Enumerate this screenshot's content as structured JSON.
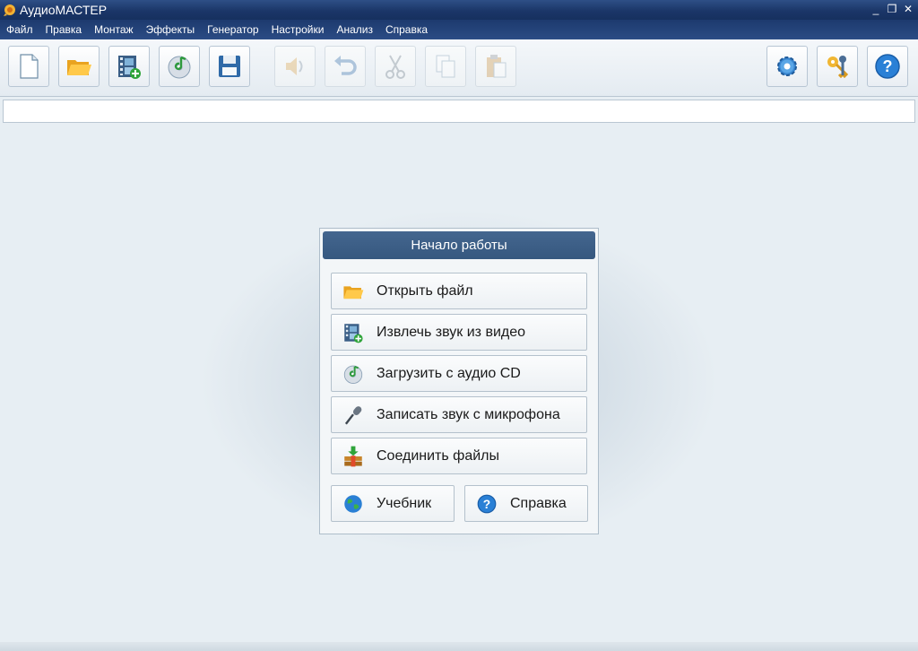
{
  "window": {
    "title": "АудиоМАСТЕР",
    "controls": {
      "minimize": "_",
      "restore": "❐",
      "close": "✕"
    }
  },
  "menu": {
    "items": [
      "Файл",
      "Правка",
      "Монтаж",
      "Эффекты",
      "Генератор",
      "Настройки",
      "Анализ",
      "Справка"
    ]
  },
  "toolbar": {
    "buttons": [
      {
        "icon": "new-file-icon",
        "enabled": true
      },
      {
        "icon": "open-folder-icon",
        "enabled": true
      },
      {
        "icon": "extract-video-icon",
        "enabled": true
      },
      {
        "icon": "audio-cd-icon",
        "enabled": true
      },
      {
        "icon": "save-icon",
        "enabled": true
      },
      {
        "icon": "speaker-icon",
        "enabled": false
      },
      {
        "icon": "undo-icon",
        "enabled": false
      },
      {
        "icon": "cut-icon",
        "enabled": false
      },
      {
        "icon": "copy-icon",
        "enabled": false
      },
      {
        "icon": "paste-icon",
        "enabled": false
      },
      {
        "icon": "settings-gear-icon",
        "enabled": true
      },
      {
        "icon": "keys-icon",
        "enabled": true
      },
      {
        "icon": "help-icon",
        "enabled": true
      }
    ]
  },
  "start_panel": {
    "title": "Начало работы",
    "actions": [
      {
        "label": "Открыть файл",
        "icon": "open-folder-icon"
      },
      {
        "label": "Извлечь звук из видео",
        "icon": "extract-video-icon"
      },
      {
        "label": "Загрузить с аудио CD",
        "icon": "audio-cd-icon"
      },
      {
        "label": "Записать звук с микрофона",
        "icon": "microphone-icon"
      },
      {
        "label": "Соединить файлы",
        "icon": "join-files-icon"
      }
    ],
    "tutorial_label": "Учебник",
    "help_label": "Справка"
  },
  "colors": {
    "titlebar": "#1b3668",
    "panel_header": "#3d5f88",
    "workspace": "#e7eef3"
  }
}
